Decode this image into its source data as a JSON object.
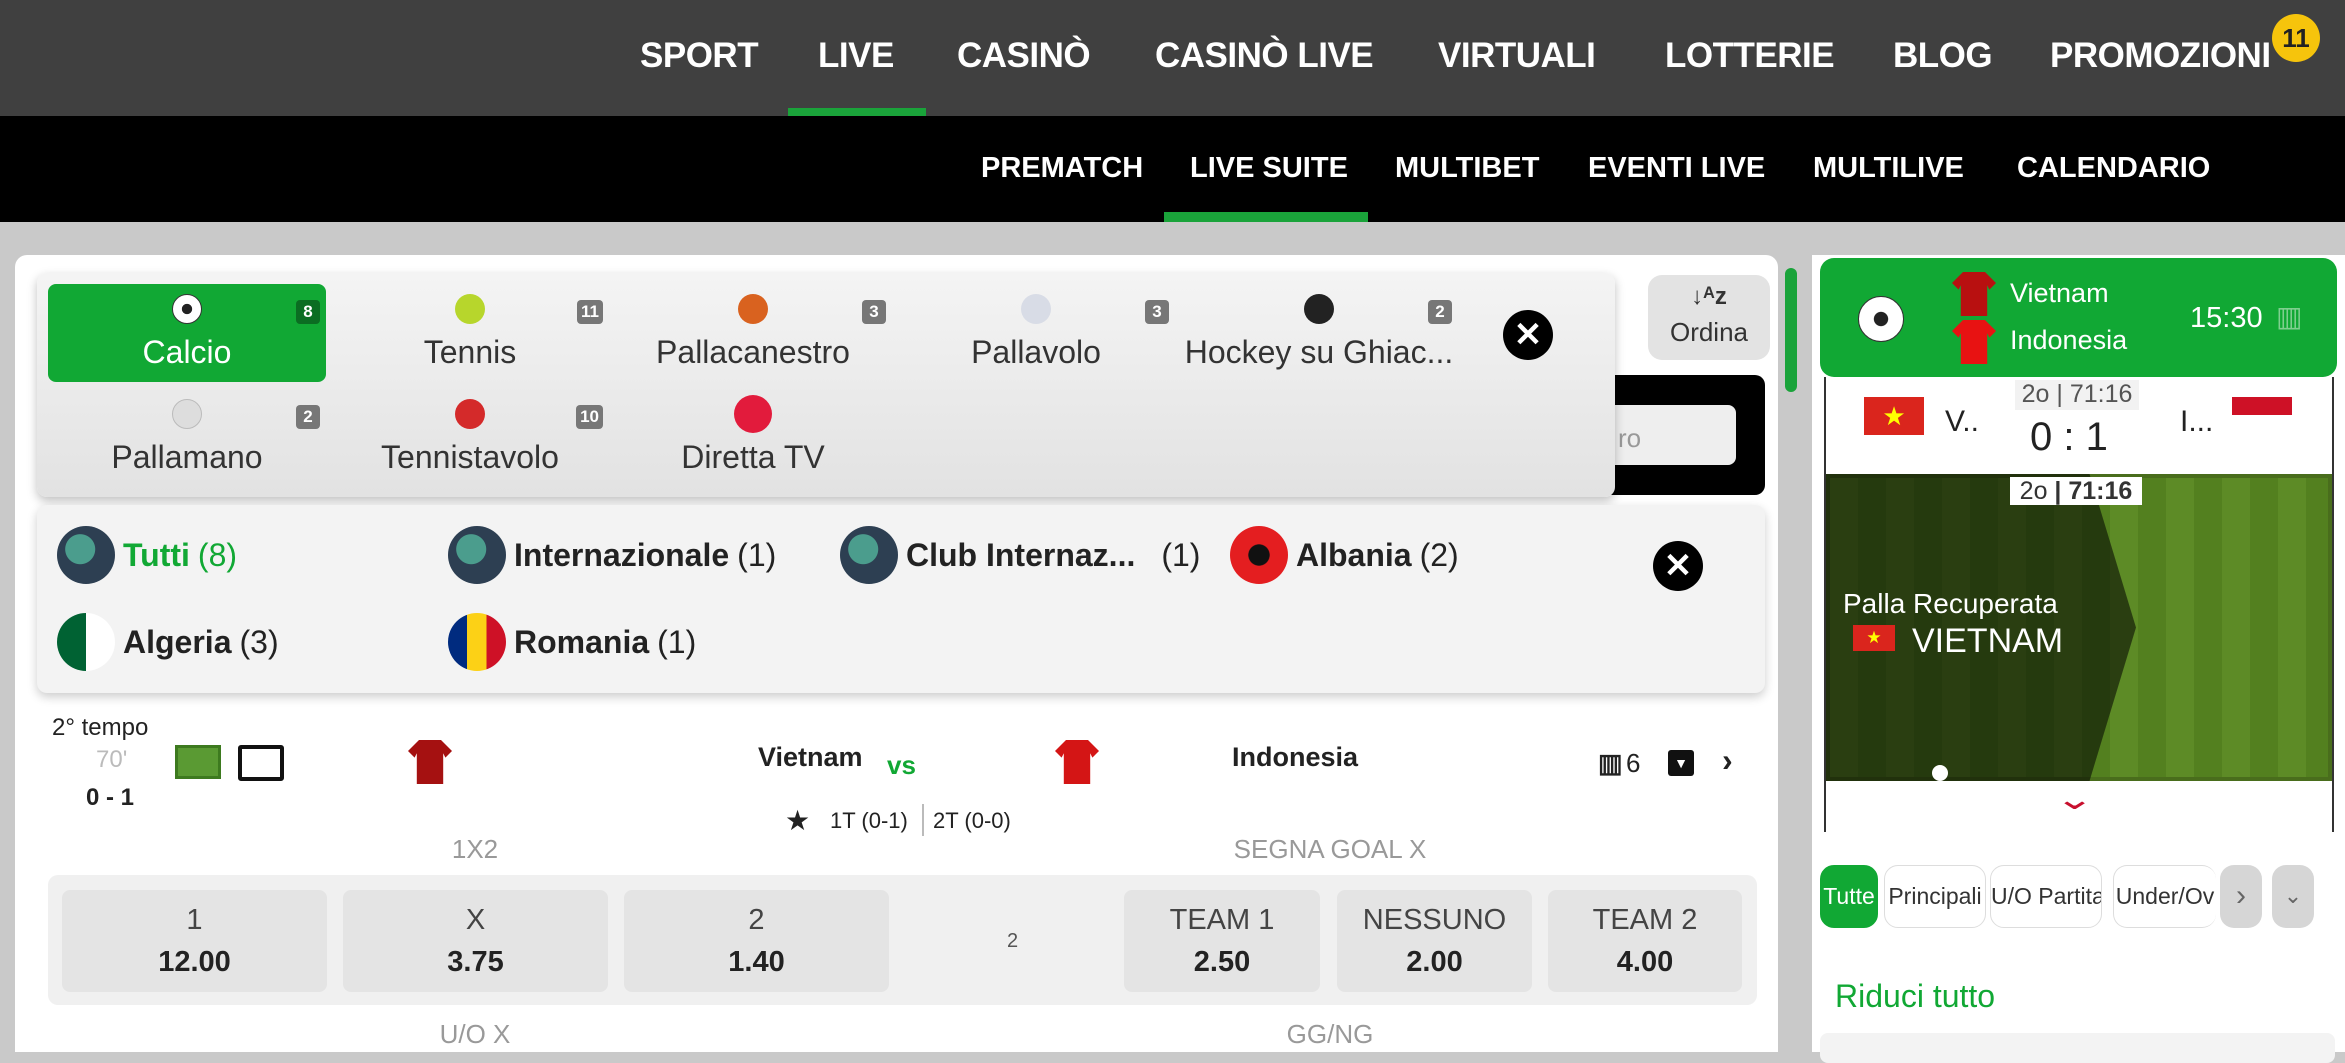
{
  "colors": {
    "accent": "#11a834",
    "topbar": "#404040",
    "badge": "#f6c40c",
    "live_red": "#e21b3c"
  },
  "top_nav": {
    "items": [
      "SPORT",
      "LIVE",
      "CASINÒ",
      "CASINÒ LIVE",
      "VIRTUALI",
      "LOTTERIE",
      "BLOG",
      "PROMOZIONI"
    ],
    "active": "LIVE",
    "promo_badge": "11"
  },
  "sub_nav": {
    "items": [
      "PREMATCH",
      "LIVE SUITE",
      "MULTIBET",
      "EVENTI LIVE",
      "MULTILIVE",
      "CALENDARIO"
    ],
    "active": "LIVE SUITE"
  },
  "sports": [
    {
      "label": "Calcio",
      "count": "8",
      "icon": "soccer-ball-icon",
      "active": true
    },
    {
      "label": "Tennis",
      "count": "11",
      "icon": "tennis-ball-icon"
    },
    {
      "label": "Pallacanestro",
      "count": "3",
      "icon": "basketball-icon"
    },
    {
      "label": "Pallavolo",
      "count": "3",
      "icon": "volleyball-icon"
    },
    {
      "label": "Hockey su Ghiac...",
      "count": "2",
      "icon": "hockey-puck-icon"
    },
    {
      "label": "Pallamano",
      "count": "2",
      "icon": "handball-icon"
    },
    {
      "label": "Tennistavolo",
      "count": "10",
      "icon": "ping-pong-icon"
    },
    {
      "label": "Diretta TV",
      "icon": "live-tv-icon"
    }
  ],
  "sort": {
    "label": "Ordina",
    "icon": "sort-az-icon"
  },
  "search": {
    "placeholder": "ro"
  },
  "countries": [
    {
      "name": "Tutti",
      "count": "(8)",
      "active": true
    },
    {
      "name": "Internazionale",
      "count": "(1)"
    },
    {
      "name": "Club Internaz...",
      "count": "(1)"
    },
    {
      "name": "Albania",
      "count": "(2)"
    },
    {
      "name": "Algeria",
      "count": "(3)"
    },
    {
      "name": "Romania",
      "count": "(1)"
    }
  ],
  "match": {
    "period": "2° tempo",
    "minute": "70'",
    "score": "0 - 1",
    "home": "Vietnam",
    "vs": "vs",
    "away": "Indonesia",
    "stats_count": "6",
    "half1": "1T (0-1)",
    "half2": "2T (0-0)",
    "markets": {
      "m1": "1X2",
      "m2": "SEGNA GOAL X",
      "m3": "U/O X",
      "m4": "GG/NG"
    },
    "odds_1x2": [
      {
        "label": "1",
        "value": "12.00"
      },
      {
        "label": "X",
        "value": "3.75"
      },
      {
        "label": "2",
        "value": "1.40"
      }
    ],
    "middle": "2",
    "odds_goal": [
      {
        "label": "TEAM 1",
        "value": "2.50"
      },
      {
        "label": "NESSUNO",
        "value": "2.00"
      },
      {
        "label": "TEAM 2",
        "value": "4.00"
      }
    ]
  },
  "side": {
    "home": "Vietnam",
    "away": "Indonesia",
    "time": "15:30",
    "home_short": "V..",
    "away_short": "I...",
    "clock_period": "2o",
    "clock": "71:16",
    "score": "0 : 1",
    "event_text": "Palla Recuperata",
    "event_team": "VIETNAM",
    "tabs": [
      "Tutte",
      "Principali",
      "U/O Partita",
      "Under/Ov"
    ],
    "collapse": "Riduci tutto"
  }
}
